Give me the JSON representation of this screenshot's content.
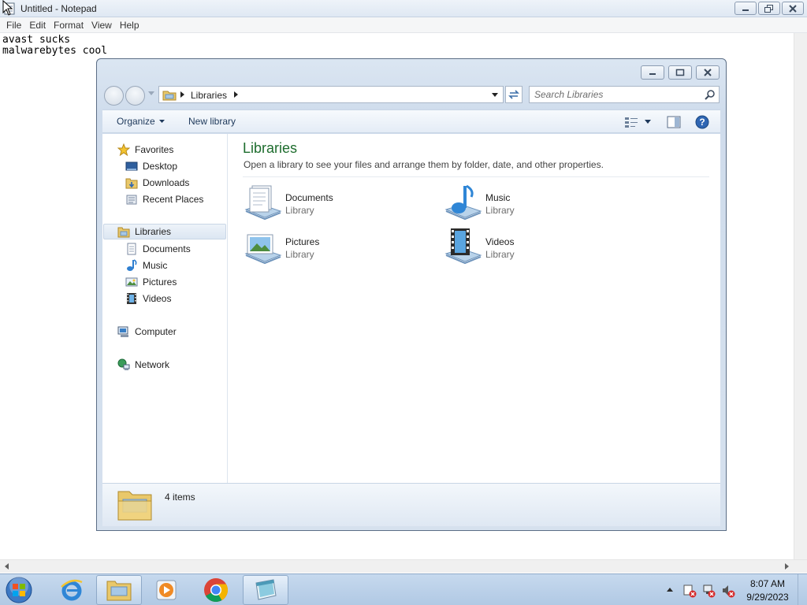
{
  "notepad": {
    "title": "Untitled - Notepad",
    "menu": [
      "File",
      "Edit",
      "Format",
      "View",
      "Help"
    ],
    "text": "avast sucks\nmalwarebytes cool"
  },
  "explorer": {
    "address": {
      "crumb": "Libraries"
    },
    "search": {
      "placeholder": "Search Libraries"
    },
    "toolbar": {
      "organize": "Organize",
      "new_library": "New library"
    },
    "nav": {
      "favorites": "Favorites",
      "desktop": "Desktop",
      "downloads": "Downloads",
      "recent": "Recent Places",
      "libraries": "Libraries",
      "documents": "Documents",
      "music": "Music",
      "pictures": "Pictures",
      "videos": "Videos",
      "computer": "Computer",
      "network": "Network"
    },
    "content": {
      "title": "Libraries",
      "description": "Open a library to see your files and arrange them by folder, date, and other properties.",
      "items": [
        {
          "name": "Documents",
          "type": "Library",
          "icon": "documents-library-icon"
        },
        {
          "name": "Music",
          "type": "Library",
          "icon": "music-library-icon"
        },
        {
          "name": "Pictures",
          "type": "Library",
          "icon": "pictures-library-icon"
        },
        {
          "name": "Videos",
          "type": "Library",
          "icon": "videos-library-icon"
        }
      ]
    },
    "status": {
      "count": "4 items"
    }
  },
  "taskbar": {
    "time": "8:07 AM",
    "date": "9/29/2023",
    "apps": [
      "internet-explorer-icon",
      "explorer-icon",
      "media-player-icon",
      "chrome-icon",
      "notepad-icon"
    ]
  },
  "colors": {
    "content_title": "#1e6d2e",
    "taskbar": "#b8cfe8",
    "toolbar_text": "#1e395b"
  }
}
